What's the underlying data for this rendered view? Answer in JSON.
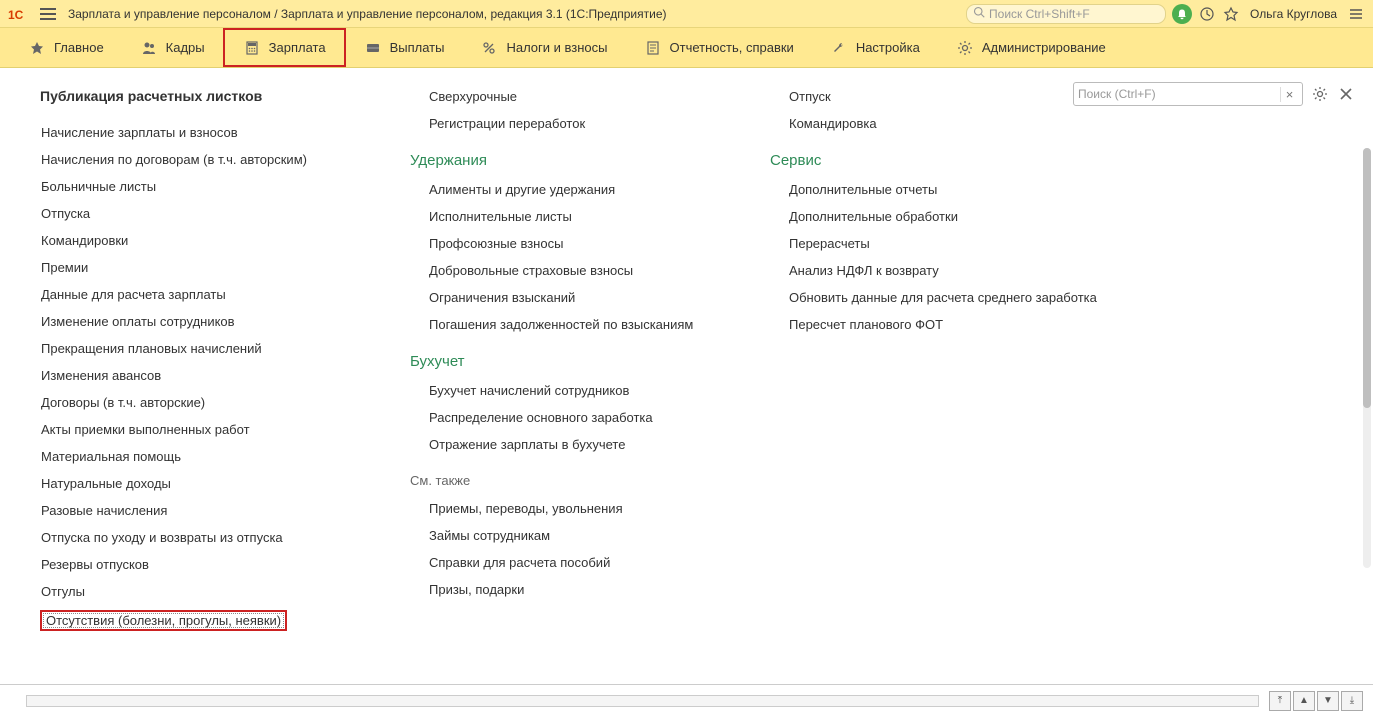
{
  "header": {
    "title": "Зарплата и управление персоналом / Зарплата и управление персоналом, редакция 3.1  (1С:Предприятие)",
    "search_placeholder": "Поиск Ctrl+Shift+F",
    "user": "Ольга Круглова"
  },
  "menu": {
    "items": [
      {
        "label": "Главное",
        "icon": "star"
      },
      {
        "label": "Кадры",
        "icon": "people"
      },
      {
        "label": "Зарплата",
        "icon": "calc",
        "active": true
      },
      {
        "label": "Выплаты",
        "icon": "wallet"
      },
      {
        "label": "Налоги и взносы",
        "icon": "percent"
      },
      {
        "label": "Отчетность, справки",
        "icon": "report"
      },
      {
        "label": "Настройка",
        "icon": "wrench"
      },
      {
        "label": "Администрирование",
        "icon": "gear"
      }
    ]
  },
  "toolbox": {
    "search_placeholder": "Поиск (Ctrl+F)"
  },
  "col1": {
    "title": "Публикация расчетных листков",
    "items": [
      "Начисление зарплаты и взносов",
      "Начисления по договорам (в т.ч. авторским)",
      "Больничные листы",
      "Отпуска",
      "Командировки",
      "Премии",
      "Данные для расчета зарплаты",
      "Изменение оплаты сотрудников",
      "Прекращения плановых начислений",
      "Изменения авансов",
      "Договоры (в т.ч. авторские)",
      "Акты приемки выполненных работ",
      "Материальная помощь",
      "Натуральные доходы",
      "Разовые начисления",
      "Отпуска по уходу и возвраты из отпуска",
      "Резервы отпусков",
      "Отгулы",
      "Отсутствия (болезни, прогулы, неявки)"
    ]
  },
  "col2": {
    "top_items": [
      "Сверхурочные",
      "Регистрации переработок"
    ],
    "group1_header": "Удержания",
    "group1_items": [
      "Алименты и другие удержания",
      "Исполнительные листы",
      "Профсоюзные взносы",
      "Добровольные страховые взносы",
      "Ограничения взысканий",
      "Погашения задолженностей по взысканиям"
    ],
    "group2_header": "Бухучет",
    "group2_items": [
      "Бухучет начислений сотрудников",
      "Распределение основного заработка",
      "Отражение зарплаты в бухучете"
    ],
    "see_also_label": "См. также",
    "see_also_items": [
      "Приемы, переводы, увольнения",
      "Займы сотрудникам",
      "Справки для расчета пособий",
      "Призы, подарки"
    ]
  },
  "col3": {
    "top_items": [
      "Отпуск",
      "Командировка"
    ],
    "group1_header": "Сервис",
    "group1_items": [
      "Дополнительные отчеты",
      "Дополнительные обработки",
      "Перерасчеты",
      "Анализ НДФЛ к возврату",
      "Обновить данные для расчета среднего заработка",
      "Пересчет планового ФОТ"
    ]
  }
}
